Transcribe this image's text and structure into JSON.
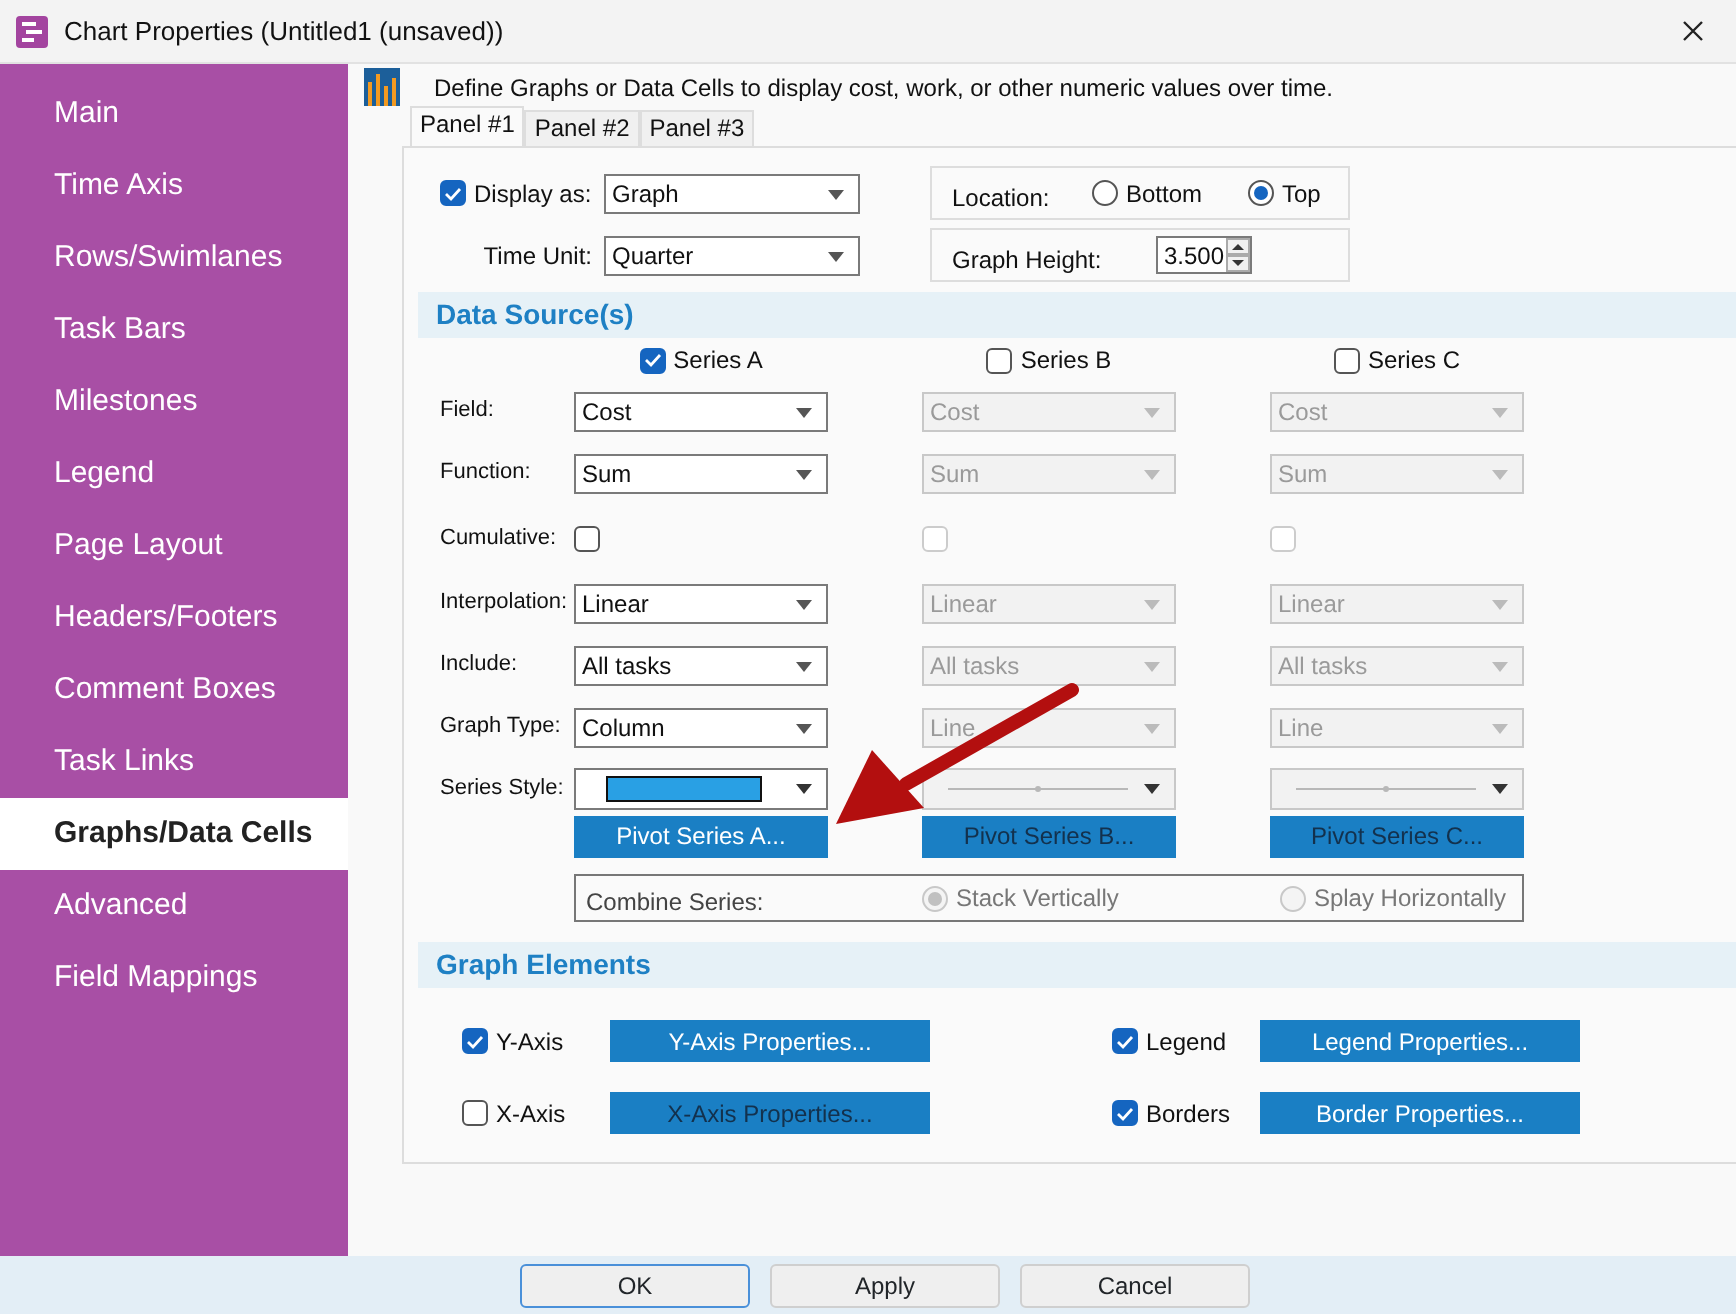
{
  "window": {
    "title": "Chart Properties (Untitled1 (unsaved))"
  },
  "sidebar": {
    "items": [
      {
        "label": "Main",
        "selected": false
      },
      {
        "label": "Time Axis",
        "selected": false
      },
      {
        "label": "Rows/Swimlanes",
        "selected": false
      },
      {
        "label": "Task Bars",
        "selected": false
      },
      {
        "label": "Milestones",
        "selected": false
      },
      {
        "label": "Legend",
        "selected": false
      },
      {
        "label": "Page Layout",
        "selected": false
      },
      {
        "label": "Headers/Footers",
        "selected": false
      },
      {
        "label": "Comment Boxes",
        "selected": false
      },
      {
        "label": "Task Links",
        "selected": false
      },
      {
        "label": "Graphs/Data Cells",
        "selected": true
      },
      {
        "label": "Advanced",
        "selected": false
      },
      {
        "label": "Field Mappings",
        "selected": false
      }
    ]
  },
  "description": "Define Graphs or Data Cells to display cost, work, or other numeric values over time.",
  "tabs": [
    {
      "label": "Panel #1",
      "selected": true
    },
    {
      "label": "Panel #2",
      "selected": false
    },
    {
      "label": "Panel #3",
      "selected": false
    }
  ],
  "display_as": {
    "label": "Display as:",
    "checked": true,
    "value": "Graph"
  },
  "time_unit": {
    "label": "Time Unit:",
    "value": "Quarter"
  },
  "location": {
    "label": "Location:",
    "options": [
      {
        "label": "Bottom",
        "selected": false
      },
      {
        "label": "Top",
        "selected": true
      }
    ]
  },
  "graph_height": {
    "label": "Graph Height:",
    "value": "3.500"
  },
  "data_source": {
    "title": "Data Source(s)",
    "series": [
      {
        "label": "Series A",
        "checked": true
      },
      {
        "label": "Series B",
        "checked": false
      },
      {
        "label": "Series C",
        "checked": false
      }
    ],
    "rows": [
      {
        "label": "Field:",
        "kind": "select",
        "cells": [
          {
            "value": "Cost"
          },
          {
            "value": "Cost"
          },
          {
            "value": "Cost"
          }
        ]
      },
      {
        "label": "Function:",
        "kind": "select",
        "cells": [
          {
            "value": "Sum"
          },
          {
            "value": "Sum"
          },
          {
            "value": "Sum"
          }
        ]
      },
      {
        "label": "Cumulative:",
        "kind": "checkbox",
        "cells": [
          {
            "checked": false
          },
          {
            "checked": false
          },
          {
            "checked": false
          }
        ]
      },
      {
        "label": "Interpolation:",
        "kind": "select",
        "cells": [
          {
            "value": "Linear"
          },
          {
            "value": "Linear"
          },
          {
            "value": "Linear"
          }
        ]
      },
      {
        "label": "Include:",
        "kind": "select",
        "cells": [
          {
            "value": "All tasks"
          },
          {
            "value": "All tasks"
          },
          {
            "value": "All tasks"
          }
        ]
      },
      {
        "label": "Graph Type:",
        "kind": "select",
        "cells": [
          {
            "value": "Column"
          },
          {
            "value": "Line"
          },
          {
            "value": "Line"
          }
        ]
      },
      {
        "label": "Series Style:",
        "kind": "style",
        "cells": [
          {
            "kind": "swatch",
            "color": "#29a0e4"
          },
          {
            "kind": "line"
          },
          {
            "kind": "line"
          }
        ]
      }
    ],
    "pivot_buttons": [
      "Pivot Series A...",
      "Pivot Series B...",
      "Pivot Series C..."
    ],
    "combine": {
      "label": "Combine Series:",
      "disabled": true,
      "options": [
        {
          "label": "Stack Vertically",
          "selected": true
        },
        {
          "label": "Splay Horizontally",
          "selected": false
        }
      ]
    }
  },
  "graph_elements": {
    "title": "Graph Elements",
    "items": [
      {
        "label": "Y-Axis",
        "checked": true,
        "button": "Y-Axis Properties..."
      },
      {
        "label": "Legend",
        "checked": true,
        "button": "Legend Properties..."
      },
      {
        "label": "X-Axis",
        "checked": false,
        "button": "X-Axis Properties..."
      },
      {
        "label": "Borders",
        "checked": true,
        "button": "Border Properties..."
      }
    ]
  },
  "footer_buttons": [
    "OK",
    "Apply",
    "Cancel"
  ]
}
